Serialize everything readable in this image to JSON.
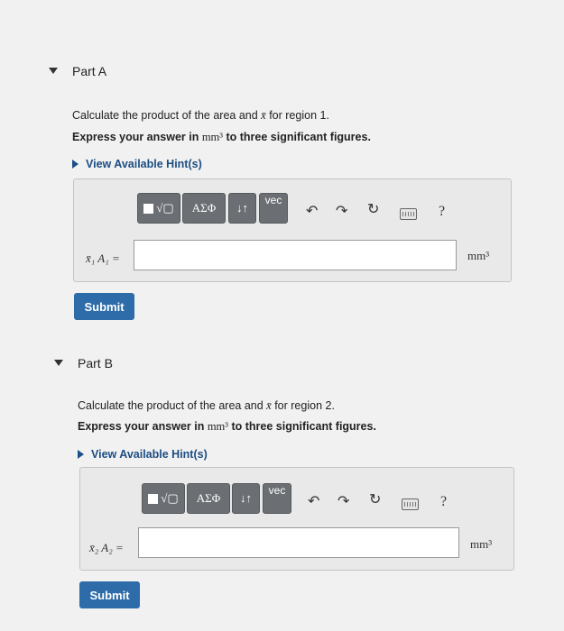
{
  "partA": {
    "title": "Part A",
    "question_pre": "Calculate the product of the area and ",
    "xbar": "x̄",
    "question_post": " for region 1.",
    "express_pre": "Express your answer in ",
    "express_unit": "mm³",
    "express_post": " to three significant figures.",
    "hint": "View Available Hint(s)",
    "toolbar": {
      "templates": "√▢",
      "greek": "ΑΣΦ",
      "sort": "↓↑",
      "vec": "vec",
      "help": "?"
    },
    "answer_label": "x̄₁ A₁ =",
    "answer_value": "",
    "unit": "mm³",
    "submit": "Submit"
  },
  "partB": {
    "title": "Part B",
    "question_pre": "Calculate the product of the area and ",
    "xbar": "x̄",
    "question_post": " for region 2.",
    "express_pre": "Express your answer in ",
    "express_unit": "mm³",
    "express_post": " to three significant figures.",
    "hint": "View Available Hint(s)",
    "toolbar": {
      "templates": "√▢",
      "greek": "ΑΣΦ",
      "sort": "↓↑",
      "vec": "vec",
      "help": "?"
    },
    "answer_label": "x̄₂ A₂ =",
    "answer_value": "",
    "unit": "mm³",
    "submit": "Submit"
  }
}
